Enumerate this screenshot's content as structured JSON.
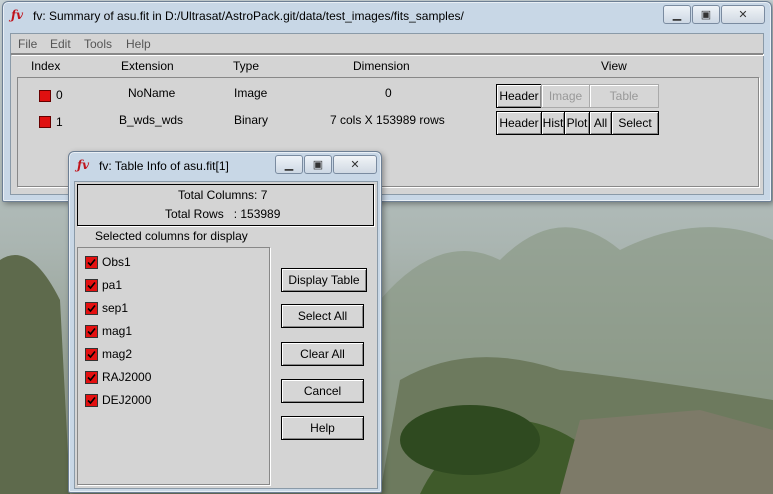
{
  "main_window": {
    "title": "fv: Summary of asu.fit in D:/Ultrasat/AstroPack.git/data/test_images/fits_samples/",
    "menu": [
      "File",
      "Edit",
      "Tools",
      "Help"
    ],
    "columns": [
      "Index",
      "Extension",
      "Type",
      "Dimension",
      "View"
    ],
    "rows": [
      {
        "index": "0",
        "extension": "NoName",
        "type": "Image",
        "dimension": "0"
      },
      {
        "index": "1",
        "extension": "B_wds_wds",
        "type": "Binary",
        "dimension": "7 cols X 153989 rows"
      }
    ],
    "row0_buttons": [
      "Header",
      "Image",
      "Table"
    ],
    "row1_buttons": [
      "Header",
      "Hist",
      "Plot",
      "All",
      "Select"
    ]
  },
  "table_window": {
    "title": "fv: Table Info of asu.fit[1]",
    "total_columns": "Total Columns: 7",
    "total_rows": "Total Rows   : 153989",
    "selected_label": "Selected columns for display",
    "columns": [
      "Obs1",
      "pa1",
      "sep1",
      "mag1",
      "mag2",
      "RAJ2000",
      "DEJ2000"
    ],
    "buttons": {
      "display_table": "Display Table",
      "select_all": "Select All",
      "clear_all": "Clear All",
      "cancel": "Cancel",
      "help": "Help"
    }
  },
  "title_icon": "fv-logo-icon",
  "colors": {
    "checkbox": "#e41010",
    "window_frame": "#c8d7e6",
    "client": "#d4d4d4"
  }
}
